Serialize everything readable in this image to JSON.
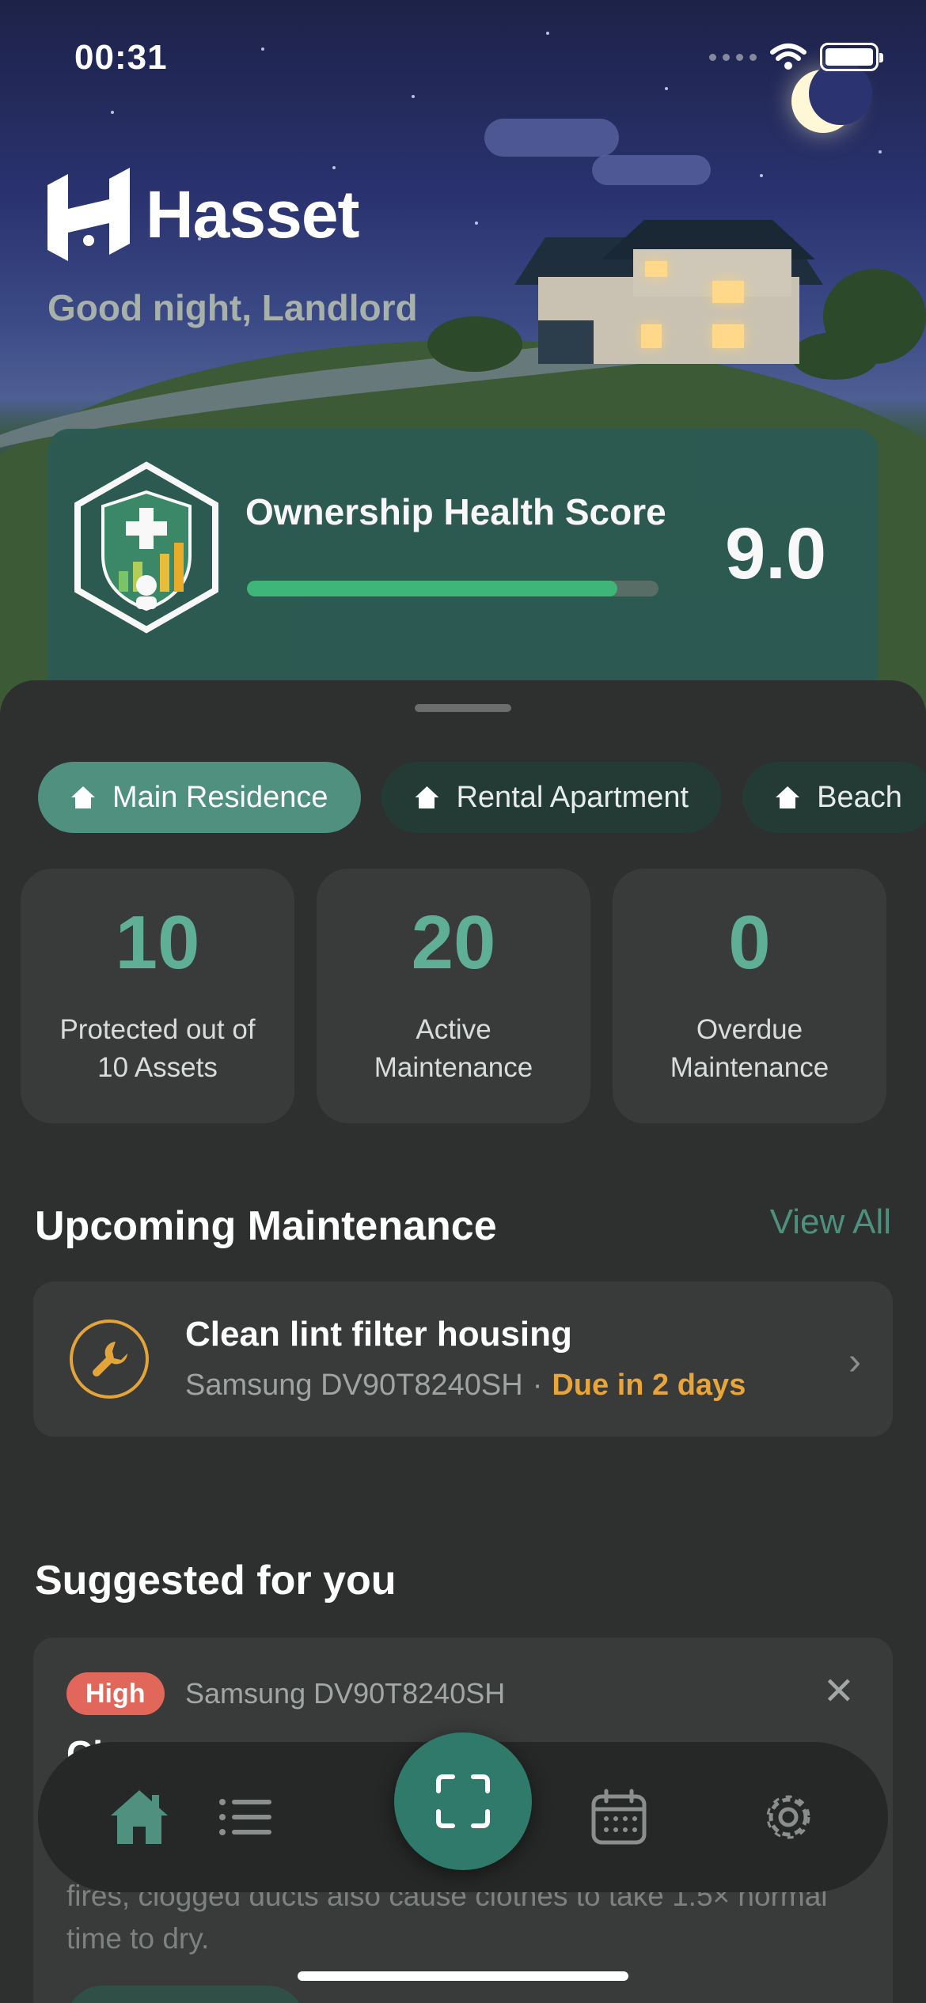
{
  "status_bar": {
    "time": "00:31"
  },
  "app": {
    "logo_text": "Hasset",
    "greeting": "Good night, Landlord"
  },
  "health": {
    "title": "Ownership Health Score",
    "score": "9.0",
    "progress_fraction": 0.9
  },
  "properties": [
    {
      "label": "Main Residence",
      "active": true
    },
    {
      "label": "Rental Apartment",
      "active": false
    },
    {
      "label": "Beach",
      "active": false
    }
  ],
  "stats": [
    {
      "value": "10",
      "label": "Protected out of 10 Assets"
    },
    {
      "value": "20",
      "label": "Active Maintenance"
    },
    {
      "value": "0",
      "label": "Overdue Maintenance"
    }
  ],
  "upcoming": {
    "title": "Upcoming Maintenance",
    "view_all": "View All",
    "item": {
      "title": "Clean lint filter housing",
      "device": "Samsung DV90T8240SH",
      "separator": "·",
      "due": "Due in 2 days",
      "icon": "wrench-icon"
    }
  },
  "suggested": {
    "title": "Suggested for you",
    "card": {
      "priority": "High",
      "device": "Samsung DV90T8240SH",
      "title_partial": "Cl",
      "body": "fires, clogged ducts also cause clothes to take 1.5× normal time to dry."
    }
  },
  "tabbar": {
    "items": [
      "home-icon",
      "list-icon",
      "scan-icon",
      "calendar-icon",
      "settings-icon"
    ],
    "active": "home-icon"
  },
  "colors": {
    "accent": "#5fae96",
    "warning": "#e8a53b",
    "danger": "#e1675a",
    "card": "#393a3a",
    "background": "#2e2f2f"
  }
}
